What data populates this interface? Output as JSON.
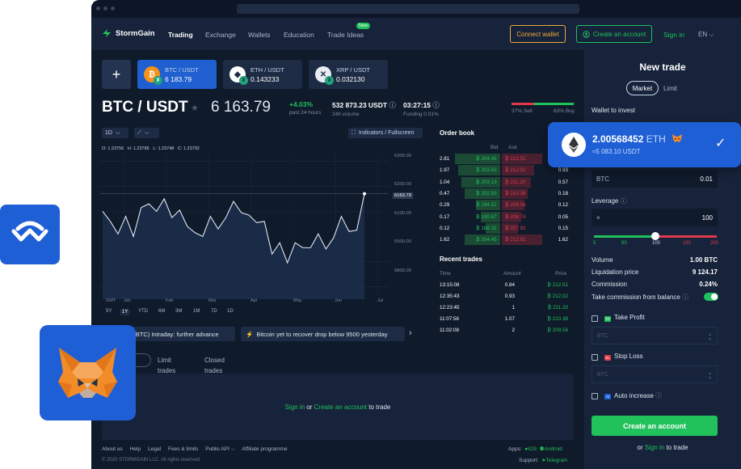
{
  "nav": {
    "brand": "StormGain",
    "links": [
      "Trading",
      "Exchange",
      "Wallets",
      "Education",
      "Trade Ideas"
    ],
    "new_badge": "New",
    "connect_wallet": "Connect wallet",
    "create_account": "Create an account",
    "sign_in": "Sign in",
    "lang": "EN"
  },
  "pairs": [
    {
      "name": "BTC / USDT",
      "price": "6 183.79",
      "symbol": "₿",
      "color": "#f7931a"
    },
    {
      "name": "ETH / USDT",
      "price": "0.143233",
      "symbol": "◆",
      "color": "#ffffff"
    },
    {
      "name": "XRP / USDT",
      "price": "0.032130",
      "symbol": "✕",
      "color": "#e8ecf2"
    }
  ],
  "plus": "+",
  "header": {
    "pair": "BTC / USDT",
    "star": "★",
    "price": "6 163.79",
    "change": "+4.03%",
    "change_label": "past 24 hours",
    "volume": "532 873.23 USDT",
    "volume_label": "24h volume",
    "funding_time": "03:27:15",
    "funding_label": "Funding 0.01%",
    "info_icon": "ⓘ",
    "sell": "37% Sell",
    "buy": "63% Buy",
    "sell_fraction": 0.37
  },
  "chart": {
    "interval": "1D",
    "indicators": "Indicators / Fullscreen",
    "ohlc": [
      "O: 1.23756",
      "H: 1.23786",
      "L: 1.23748",
      "C: 1.23792"
    ],
    "current_price": "6163.79",
    "y_ticks": [
      "6300.00",
      "6200.00",
      "6100.00",
      "5900.00",
      "5800.00"
    ],
    "x_ticks": [
      "GMT",
      "Jan",
      "Feb",
      "Mar",
      "Apr",
      "May",
      "Jun",
      "Jul"
    ],
    "timeframes": [
      "5Y",
      "1Y",
      "YTD",
      "6M",
      "3M",
      "1M",
      "7D",
      "1D"
    ],
    "active_timeframe": "1Y"
  },
  "chart_data": {
    "type": "area",
    "title": "",
    "xlabel": "",
    "ylabel": "",
    "x": [
      "Jan",
      "Feb",
      "Mar",
      "Apr",
      "May",
      "Jun",
      "Jul"
    ],
    "values": [
      6100,
      6060,
      6010,
      6080,
      6000,
      6115,
      6130,
      6100,
      6150,
      6075,
      6105,
      6040,
      6015,
      6000,
      6080,
      6030,
      6075,
      6140,
      6095,
      6085,
      6055,
      6060,
      5930,
      5975,
      5895,
      5975,
      5955,
      5955,
      6010,
      5950,
      5995,
      6080,
      6020,
      6025,
      6170
    ],
    "ylim": [
      5750,
      6330
    ],
    "grid": true
  },
  "tickers": [
    "n (BTC) Intraday: further advance",
    "Bitcoin yet to recover drop below 9500 yesterday"
  ],
  "ticker_arrow": "›",
  "positions_tabs": {
    "limit": "Limit\ntrades",
    "closed": "Closed\ntrades"
  },
  "trade_area": {
    "sign_in": "Sign in",
    "or": " or ",
    "create": "Create an account",
    "to_trade": " to trade"
  },
  "footer": {
    "links": [
      "About us",
      "Help",
      "Legal",
      "Fees & limits",
      "Public API ⌵",
      "Affiliate programme"
    ],
    "copyright": "© 2020 STORMGAIN LLC. All rights reserved.",
    "apps": "Apps:",
    "ios": "iOS",
    "android": "Android",
    "support": "Support:",
    "telegram": "Telegram"
  },
  "order_book": {
    "title": "Order book",
    "headers": [
      "Bid",
      "Ask"
    ],
    "rows": [
      {
        "bid_qty": "2.81",
        "bid": "₿ 204.45",
        "ask": "₿ 212.51",
        "ask_qty": ""
      },
      {
        "bid_qty": "1.97",
        "bid": "₿ 203.63",
        "ask": "₿ 212.02",
        "ask_qty": "0.93"
      },
      {
        "bid_qty": "1.04",
        "bid": "₿ 203.13",
        "ask": "₿ 211.20",
        "ask_qty": "0.57"
      },
      {
        "bid_qty": "0.47",
        "bid": "₿ 202.63",
        "ask": "₿ 210.38",
        "ask_qty": "0.18"
      },
      {
        "bid_qty": "0.29",
        "bid": "₿ 194.52",
        "ask": "₿ 209.56",
        "ask_qty": "0.12"
      },
      {
        "bid_qty": "0.17",
        "bid": "₿ 190.67",
        "ask": "₿ 208.74",
        "ask_qty": "0.05"
      },
      {
        "bid_qty": "0.12",
        "bid": "₿ 188.32",
        "ask": "₿ 207.92",
        "ask_qty": "0.15"
      },
      {
        "bid_qty": "1.62",
        "bid": "₿ 204.45",
        "ask": "₿ 212.51",
        "ask_qty": "1.62"
      }
    ]
  },
  "recent_trades": {
    "title": "Recent trades",
    "headers": [
      "Time",
      "Amount",
      "Price"
    ],
    "rows": [
      {
        "time": "13:15:08",
        "amount": "0.84",
        "price": "₿ 212.51"
      },
      {
        "time": "12:35:43",
        "amount": "0.93",
        "price": "₿ 212.02"
      },
      {
        "time": "12:23:45",
        "amount": "1",
        "price": "₿ 211.20"
      },
      {
        "time": "11:07:56",
        "amount": "1.07",
        "price": "₿ 210.38"
      },
      {
        "time": "11:02:08",
        "amount": "2",
        "price": "₿ 209.56"
      }
    ]
  },
  "panel": {
    "title": "New trade",
    "market": "Market",
    "limit": "Limit",
    "wallet_label": "Wallet to invest",
    "btc_field_label": "BTC",
    "btc_field_value": "0.01",
    "leverage_label": "Leverage",
    "leverage_prefix": "×",
    "leverage_value": "100",
    "leverage_ticks": [
      "5",
      "50",
      "100",
      "150",
      "200"
    ],
    "leverage_fraction": 0.5,
    "volume_label": "Volume",
    "volume_value": "1.00 BTC",
    "liq_label": "Liquidation price",
    "liq_value": "9 124.17",
    "commission_label": "Commission",
    "commission_value": "0.24%",
    "take_commission": "Take commission from balance",
    "take_profit": "Take Profit",
    "tp_tag": "TP",
    "stop_loss": "Stop Loss",
    "sl_tag": "SL",
    "auto_increase": "Auto increase",
    "ai_tag": "AI",
    "disabled_placeholder": "BTC",
    "create_button": "Create an account",
    "or_text": "or ",
    "sign_in": "Sign in",
    "to_trade": " to trade"
  },
  "wallet_card": {
    "amount": "2.00568452",
    "unit": "ETH",
    "usd": "≈5 083.10 USDT",
    "check": "✓"
  },
  "colors": {
    "accent": "#21c15b",
    "orange": "#f0a93a",
    "blue": "#1e5fd6",
    "red": "#e0394b"
  }
}
